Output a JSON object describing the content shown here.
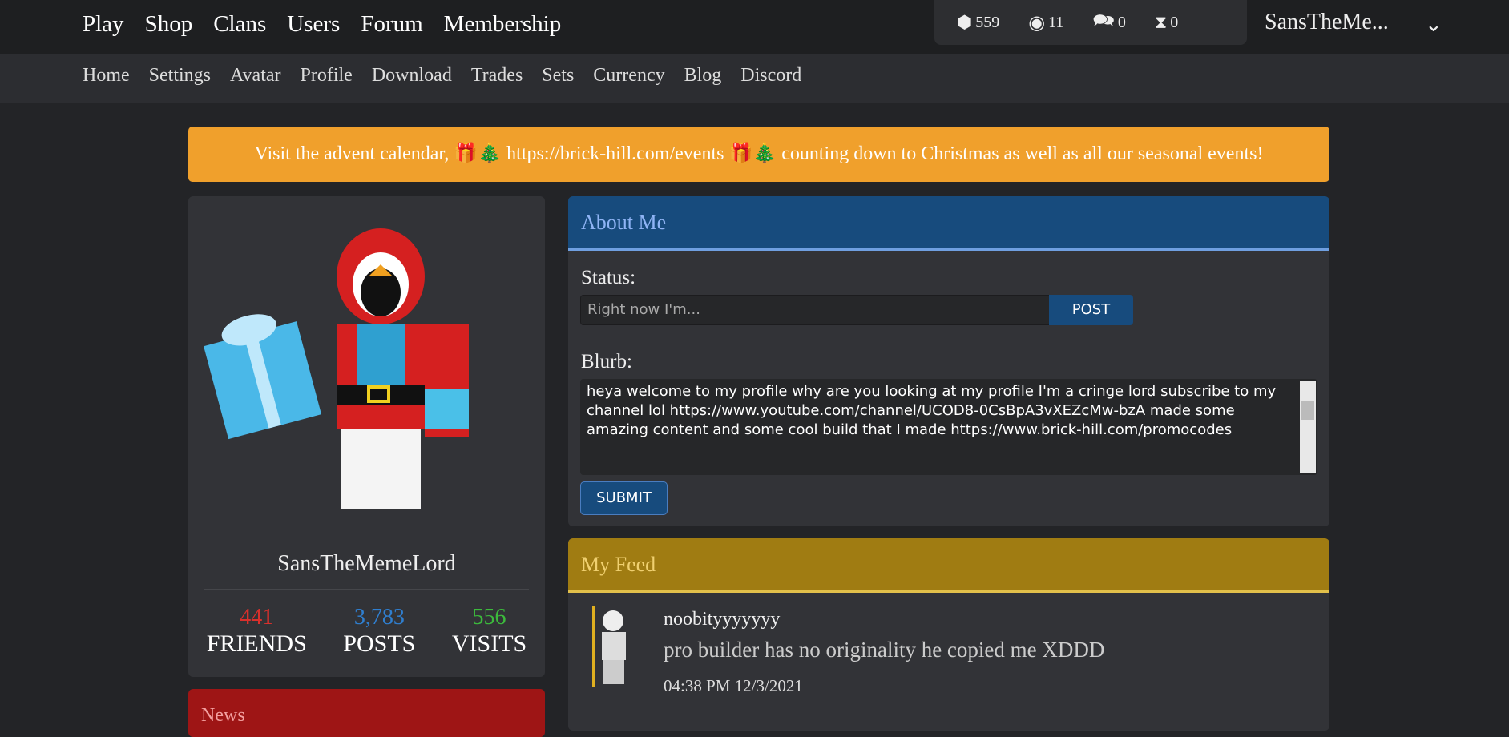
{
  "top_nav": [
    "Play",
    "Shop",
    "Clans",
    "Users",
    "Forum",
    "Membership"
  ],
  "stats": {
    "bricks": "559",
    "bits": "11",
    "messages": "0",
    "friend_requests": "0"
  },
  "user": {
    "short_name": "SansTheMe..."
  },
  "sub_nav": [
    "Home",
    "Settings",
    "Avatar",
    "Profile",
    "Download",
    "Trades",
    "Sets",
    "Currency",
    "Blog",
    "Discord"
  ],
  "banner": {
    "text": "Visit the advent calendar, 🎁🎄 https://brick-hill.com/events 🎁🎄 counting down to Christmas as well as all our seasonal events!"
  },
  "profile": {
    "name": "SansTheMemeLord",
    "friends": "441",
    "friends_label": "FRIENDS",
    "posts": "3,783",
    "posts_label": "POSTS",
    "visits": "556",
    "visits_label": "VISITS"
  },
  "colors": {
    "friends": "#d9302c",
    "posts": "#2f7fd0",
    "visits": "#3cba3c",
    "banner": "#f0a02c"
  },
  "about": {
    "title": "About Me",
    "status_label": "Status:",
    "status_placeholder": "Right now I'm...",
    "post_button": "POST",
    "blurb_label": "Blurb:",
    "blurb": "heya welcome to my profile why are you looking at my profile I'm a cringe lord subscribe to my channel lol https://www.youtube.com/channel/UCOD8-0CsBpA3vXEZcMw-bzA made some amazing content and some cool build that I made https://www.brick-hill.com/promocodes",
    "submit_button": "SUBMIT"
  },
  "feed": {
    "title": "My Feed",
    "items": [
      {
        "user": "noobityyyyyyy",
        "text": "pro builder has no originality he copied me XDDD",
        "time": "04:38 PM 12/3/2021"
      }
    ]
  },
  "news": {
    "title": "News"
  }
}
